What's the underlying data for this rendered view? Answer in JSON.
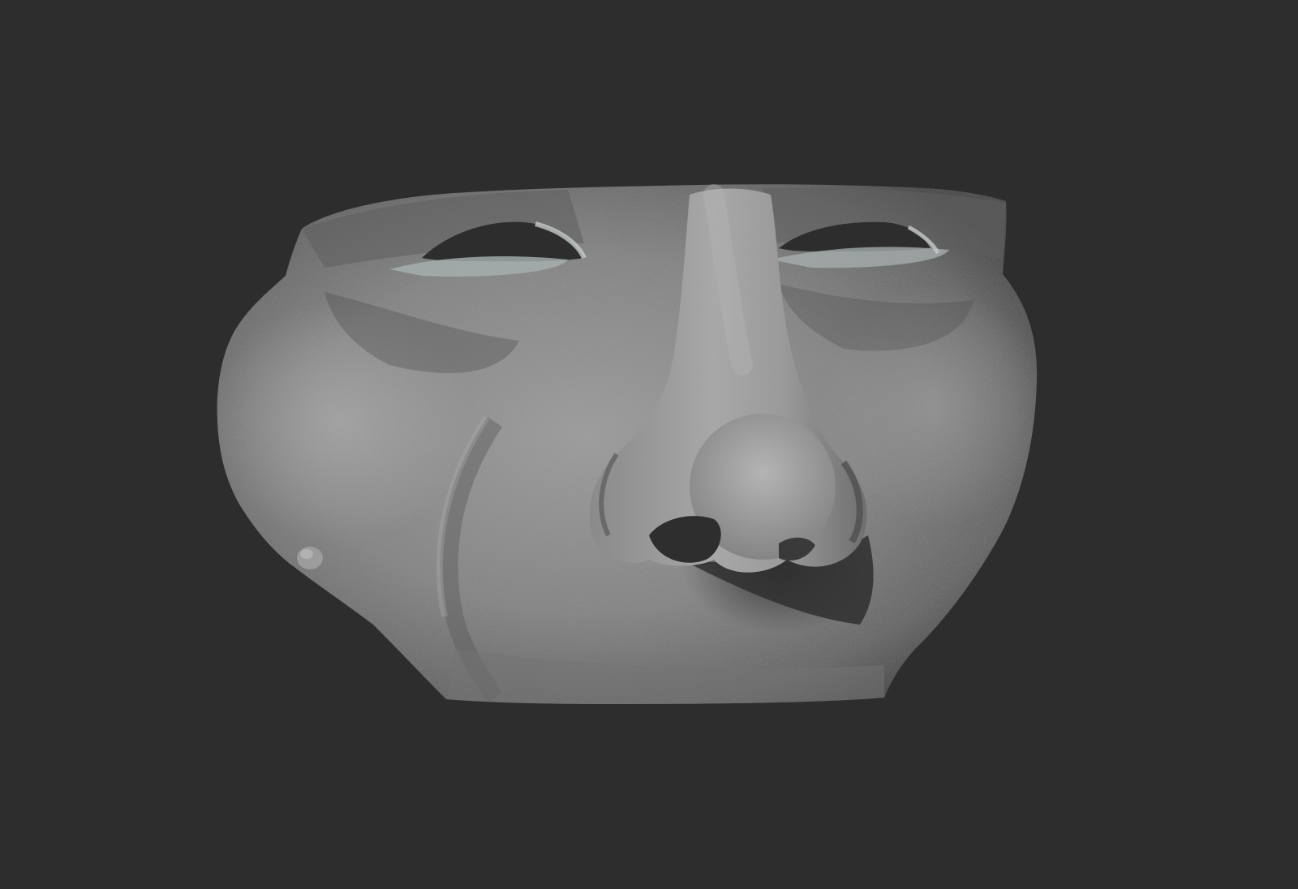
{
  "scene": {
    "subject": "face-sculpt-mask",
    "background_color": "#2d2d2d",
    "surface_color": "#8e8e8e",
    "surface_highlight": "#b3b3b3",
    "surface_shadow": "#3a3a3a",
    "eye_socket_color": "#2d2d2d",
    "eyelid_tint": "#a9b4b2"
  }
}
